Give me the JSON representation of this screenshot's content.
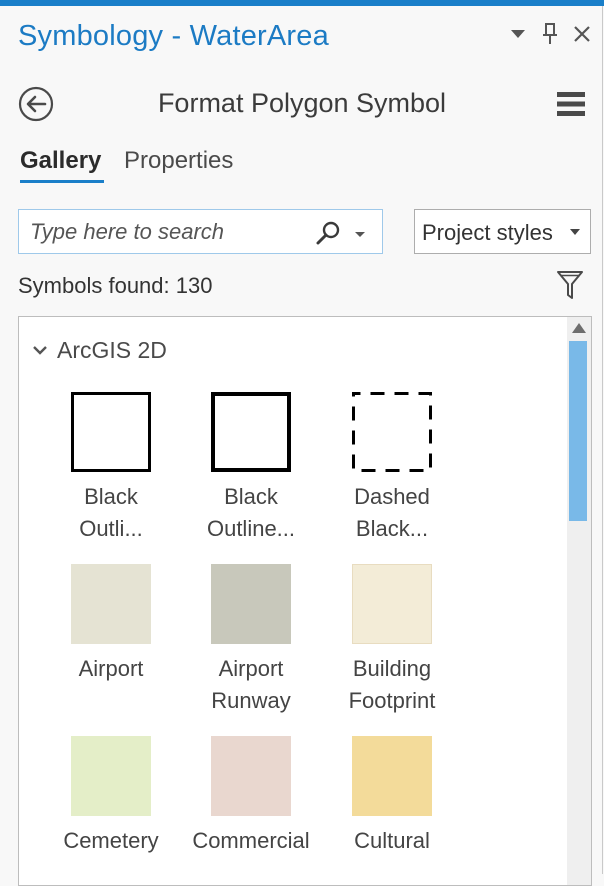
{
  "window": {
    "title": "Symbology - WaterArea",
    "buttons": {
      "options": "options-dropdown",
      "pin": "auto-hide-pin",
      "close": "close"
    }
  },
  "header": {
    "title": "Format Polygon Symbol",
    "back_icon": "back-arrow-circle",
    "menu_icon": "hamburger-menu"
  },
  "tabs": [
    {
      "label": "Gallery",
      "active": true
    },
    {
      "label": "Properties",
      "active": false
    }
  ],
  "search": {
    "placeholder": "Type here to search",
    "value": ""
  },
  "styles_dropdown": {
    "selected": "Project styles"
  },
  "symbols_found": "Symbols found: 130",
  "gallery": {
    "group": {
      "label": "ArcGIS 2D",
      "expanded": true
    },
    "symbols": [
      {
        "line1": "Black",
        "line2": "Outli...",
        "style": "outline-thin",
        "fill": "#ffffff",
        "stroke": "#000000"
      },
      {
        "line1": "Black",
        "line2": "Outline...",
        "style": "outline-thick",
        "fill": "#ffffff",
        "stroke": "#000000"
      },
      {
        "line1": "Dashed",
        "line2": "Black...",
        "style": "outline-dashed",
        "fill": "#ffffff",
        "stroke": "#000000"
      },
      {
        "line1": "Airport",
        "line2": "",
        "style": "fill",
        "fill": "#e5e3d3",
        "stroke": "#e5e3d3"
      },
      {
        "line1": "Airport",
        "line2": "Runway",
        "style": "fill",
        "fill": "#c8c8bb",
        "stroke": "#c8c8bb"
      },
      {
        "line1": "Building",
        "line2": "Footprint",
        "style": "fill",
        "fill": "#f3ecd7",
        "stroke": "#e8dcc0"
      },
      {
        "line1": "Cemetery",
        "line2": "",
        "style": "fill",
        "fill": "#e4eec8",
        "stroke": "#e4eec8"
      },
      {
        "line1": "Commercial",
        "line2": "",
        "style": "fill",
        "fill": "#e9d7cf",
        "stroke": "#e9d7cf"
      },
      {
        "line1": "Cultural",
        "line2": "",
        "style": "fill",
        "fill": "#f3db9a",
        "stroke": "#f3db9a"
      }
    ]
  },
  "colors": {
    "accent": "#1a7fc9",
    "scroll_thumb": "#79b9e8"
  }
}
